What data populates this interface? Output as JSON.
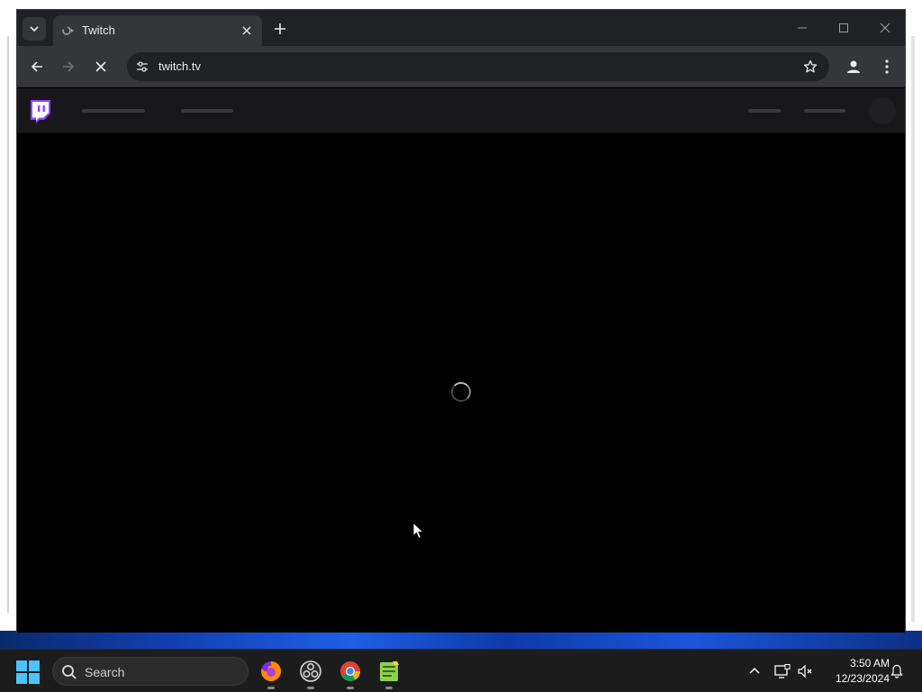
{
  "browser": {
    "tab": {
      "title": "Twitch",
      "favicon": "twitch-favicon-icon"
    },
    "address_bar": {
      "url": "twitch.tv"
    },
    "icons": {
      "tab_list": "chevron-down-icon",
      "tab_close": "close-icon",
      "new_tab": "plus-icon",
      "minimize": "minimize-icon",
      "maximize": "maximize-icon",
      "close_window": "close-icon",
      "back": "arrow-left-icon",
      "forward": "arrow-right-icon",
      "stop": "close-icon",
      "site_info": "tune-icon",
      "bookmark": "star-icon",
      "profile": "person-icon",
      "menu": "more-vertical-icon"
    }
  },
  "page": {
    "state": "loading",
    "logo": "twitch-logo-icon",
    "accent_color": "#9146ff"
  },
  "taskbar": {
    "search_label": "Search",
    "apps": [
      {
        "name": "Firefox",
        "icon": "firefox-icon"
      },
      {
        "name": "OBS Studio",
        "icon": "obs-icon"
      },
      {
        "name": "Google Chrome",
        "icon": "chrome-icon"
      },
      {
        "name": "Notepad++",
        "icon": "notepadpp-icon"
      }
    ],
    "clock": {
      "time": "3:50 AM",
      "date": "12/23/2024"
    }
  }
}
